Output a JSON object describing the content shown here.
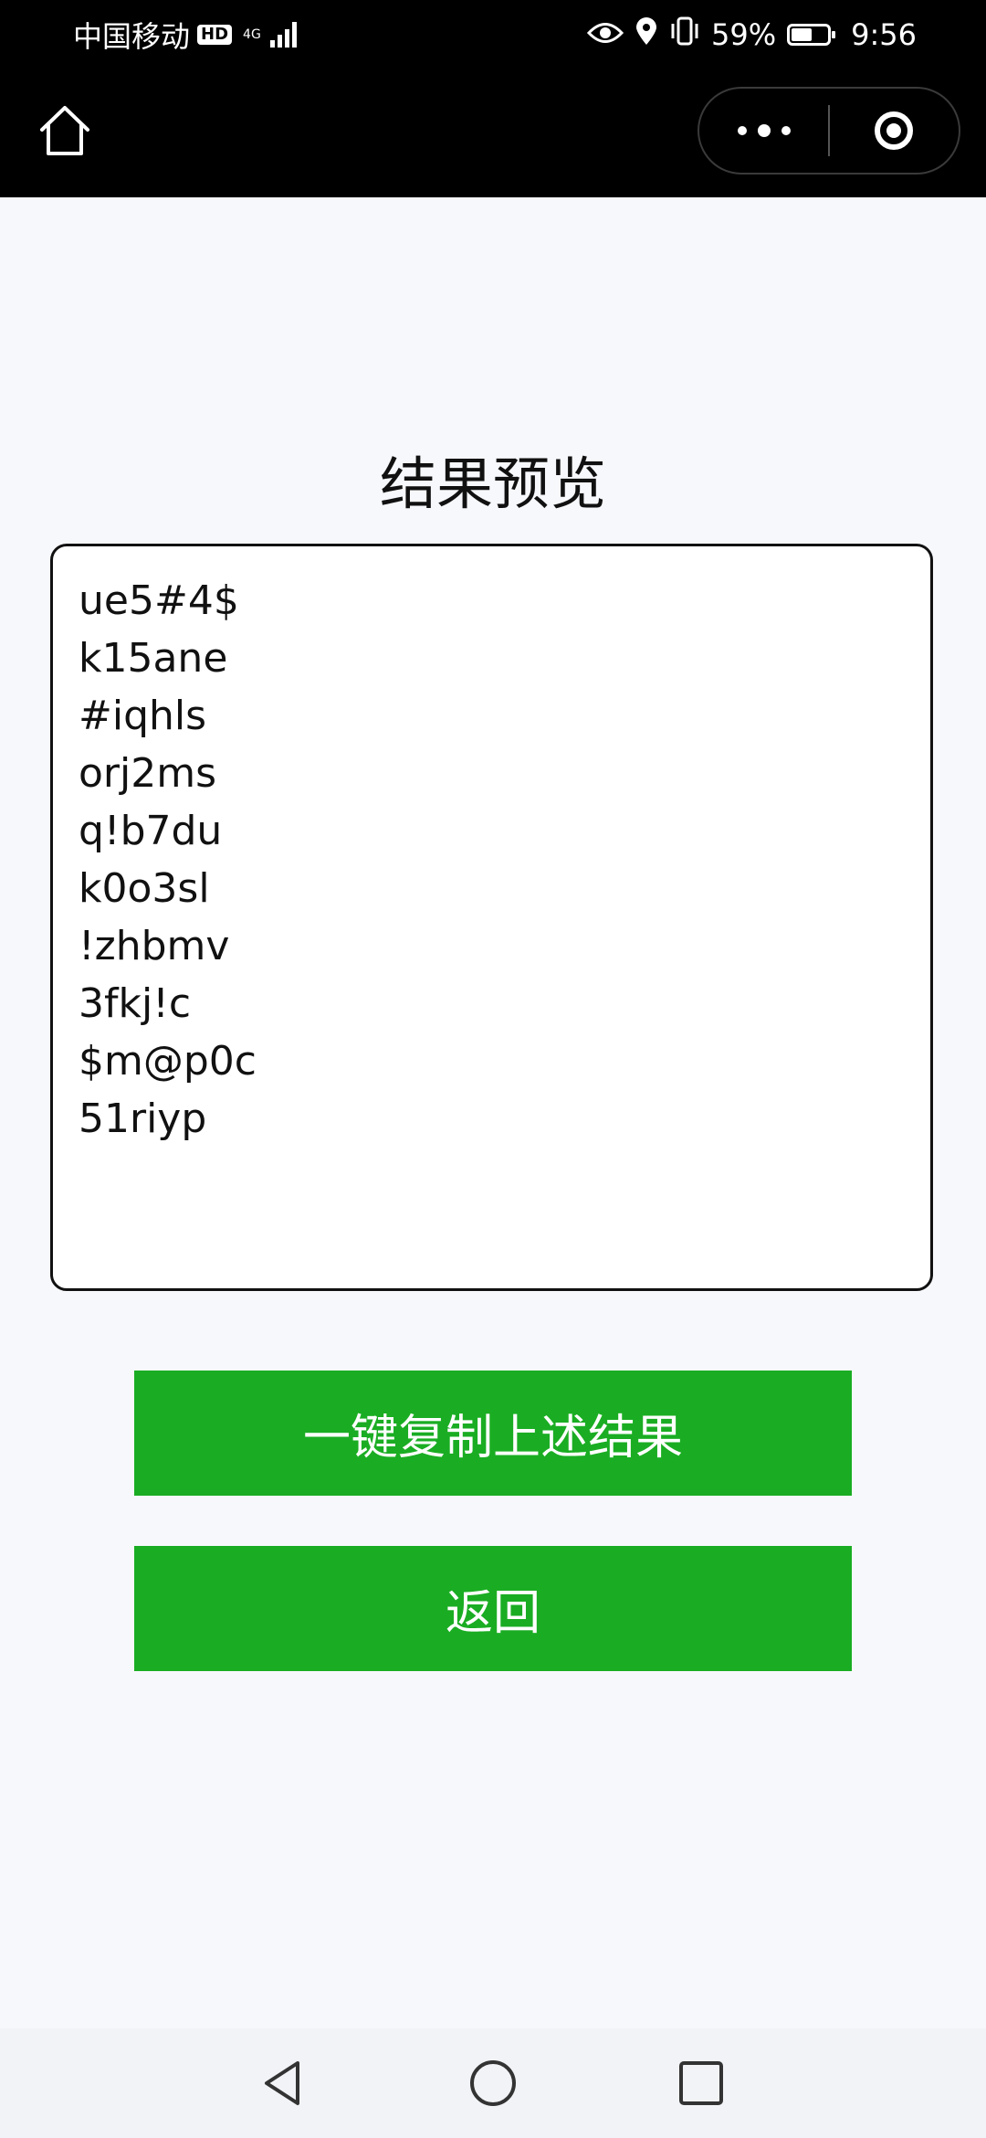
{
  "status_bar": {
    "carrier": "中国移动",
    "hd_badge": "HD",
    "network": "4G",
    "battery_percent": "59%",
    "battery_level": 0.59,
    "time": "9:56",
    "icons": [
      "eye-icon",
      "location-icon",
      "vibrate-icon",
      "battery-icon"
    ]
  },
  "header": {
    "home_icon": "home-icon",
    "more_icon": "more-dots-icon",
    "close_icon": "target-close-icon"
  },
  "main": {
    "title": "结果预览",
    "results": [
      "ue5#4$",
      "k15ane",
      "#iqhls",
      "orj2ms",
      "q!b7du",
      "k0o3sl",
      "!zhbmv",
      "3fkj!c",
      "$m@p0c",
      "51riyp"
    ],
    "copy_button": "一键复制上述结果",
    "back_button": "返回",
    "button_color": "#1aad23"
  },
  "nav_bar": {
    "back_icon": "triangle-back-icon",
    "home_icon": "circle-home-icon",
    "recents_icon": "square-recents-icon"
  }
}
